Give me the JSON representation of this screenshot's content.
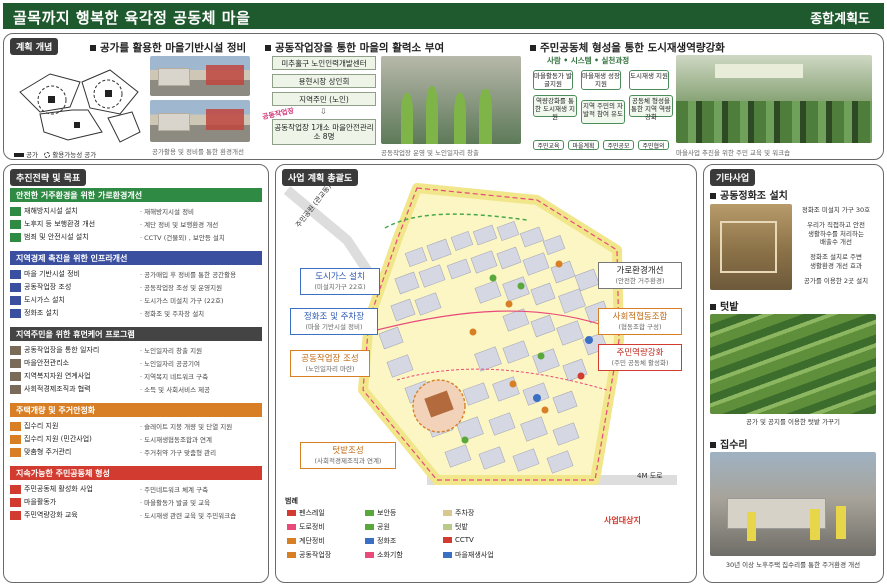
{
  "header": {
    "title": "골목까지 행복한 육각정 공동체 마을",
    "subtitle": "종합계획도"
  },
  "concept": {
    "tag": "계획 개념",
    "heads": [
      "공가를 활용한 마을기반시설 정비",
      "공동작업장을 통한 마을의 활력소 부여",
      "주민공동체 형성을 통한 도시재생역량강화"
    ],
    "minimap_legend": [
      "공가",
      "활용가능성 공가"
    ],
    "street_caption": "공가활용 및 정비를 통한 환경개선",
    "flow": [
      "미추홀구 노인인력개발센터",
      "용현시장 상인회",
      "지역주민 (노인)",
      "공동작업장 1개소 마을안전관리소 8명"
    ],
    "flow_arrow": "⇩",
    "stamp": "공동작업장",
    "meet_caption": "공동작업장 운영 및 노인일자리 창출",
    "cycle_title": "사람 • 시스템 • 실천과정",
    "cycle_boxes": [
      "마을활동가 발굴지원",
      "마을재생 성장 지원",
      "도시재생 지원",
      "역량강화를 통한 도시재생 지원",
      "지역 주민의 자발적 참여 유도",
      "공동체 형성을 통한 지역 역량 강화"
    ],
    "bottom_boxes": [
      "주민교육",
      "마을계획",
      "주민공모",
      "주민협의"
    ],
    "crowd_caption": "마을사업 추진을 위한 주민 교육 및 워크숍"
  },
  "strategy": {
    "tag": "추진전략 및 목표",
    "sections": [
      {
        "title": "안전한 거주환경을 위한 가로환경개선",
        "color": "green",
        "rows": [
          [
            "재해방지시설 설치",
            "· 재해방지시설 정비"
          ],
          [
            "노후지 등 보행환경 개선",
            "· 계단 정비 및 보행환경 개선"
          ],
          [
            "범죄 및 안전시설 설치",
            "· CCTV (건물외) , 보안등 설치"
          ]
        ]
      },
      {
        "title": "지역경제 촉진을 위한 인프라개선",
        "color": "blue",
        "rows": [
          [
            "마을 기반시설 정비",
            "· 공가매입 후 정비를 통한 공간활용"
          ],
          [
            "공동작업장 조성",
            "· 공동작업장 조성 및 운영지원"
          ],
          [
            "도시가스 설치",
            "· 도시가스 미설치 가구 (22호)"
          ],
          [
            "정화조 설치",
            "· 정화조 및 주차장 설치"
          ]
        ]
      },
      {
        "title": "지역주민을 위한 휴먼케어 프로그램",
        "color": "dark",
        "rows": [
          [
            "공동작업장을 통한 일자리",
            "· 노인일자리 창출 지원"
          ],
          [
            "마을안전관리소",
            "· 노인일자리 공공기여"
          ],
          [
            "지역복지자원 연계사업",
            "· 지역복지 네트워크 구축"
          ],
          [
            "사회적경제조직과 협력",
            "· 소득 및 사회서비스 제공"
          ]
        ]
      },
      {
        "title": "주택개량 및 주거안정화",
        "color": "orange",
        "rows": [
          [
            "집수리 지원",
            "· 슬레이트 지붕 개량 및 단열 지원"
          ],
          [
            "집수리 지원 (민간사업)",
            "· 도시재생협동조합과 연계"
          ],
          [
            "맞춤형 주거관리",
            "· 주거취약 가구 맞춤형 관리"
          ]
        ]
      },
      {
        "title": "지속가능한 주민공동체 형성",
        "color": "red",
        "rows": [
          [
            "주민공동체 활성화 사업",
            "· 주민네트워크 체계 구축"
          ],
          [
            "마을활동가",
            "· 마을활동가 발굴 및 교육"
          ],
          [
            "주민역량강화 교육",
            "· 도시재생 관련 교육 및 주민워크숍"
          ]
        ]
      }
    ]
  },
  "map": {
    "tag": "사업 계획 총괄도",
    "road_label": "주민공원 (관교동)",
    "road_bottom": "4M 도로",
    "area_label": "사업대상지",
    "callouts": {
      "gas": [
        "도시가스 설치",
        "(미설치가구 22호)"
      ],
      "septic": [
        "정화조 및 주차장",
        "(마을 기반시설 정비)"
      ],
      "workshop": [
        "공동작업장 조성",
        "(노인일자리 마련)"
      ],
      "garden": [
        "텃밭조성",
        "(사회적경제조직과 연계)"
      ],
      "street": [
        "가로환경개선",
        "(안전한 거주환경)"
      ],
      "social": [
        "사회적협동조합",
        "(협동조합 구성)"
      ],
      "capacity": [
        "주민역량강화",
        "(주민 공동체 활성화)"
      ]
    },
    "legend_title": "범례",
    "legend": [
      "펜스레일",
      "보안등",
      "주차장",
      "도로정비",
      "공원",
      "텃밭",
      "계단정비",
      "정화조",
      "CCTV",
      "공동작업장",
      "소화기함",
      "마을재생사업"
    ]
  },
  "other": {
    "tag": "기타사업",
    "items": [
      {
        "title": "공동정화조 설치",
        "text": [
          "정화조 미설치 가구 30호",
          "우리가 직접하고 안전",
          "생활하수를 처리하는",
          "배출수 개선",
          "정화조 설치로 주변",
          "생활환경 개선 효과",
          "공가를 이용한 2곳 설치"
        ]
      },
      {
        "title": "텃밭",
        "text": [
          "공가 및 공지를 이용한 텃밭 가꾸기"
        ]
      },
      {
        "title": "집수리",
        "text": [
          "30년 이상 노후주택 집수리를 통한 주거환경 개선"
        ]
      }
    ]
  }
}
